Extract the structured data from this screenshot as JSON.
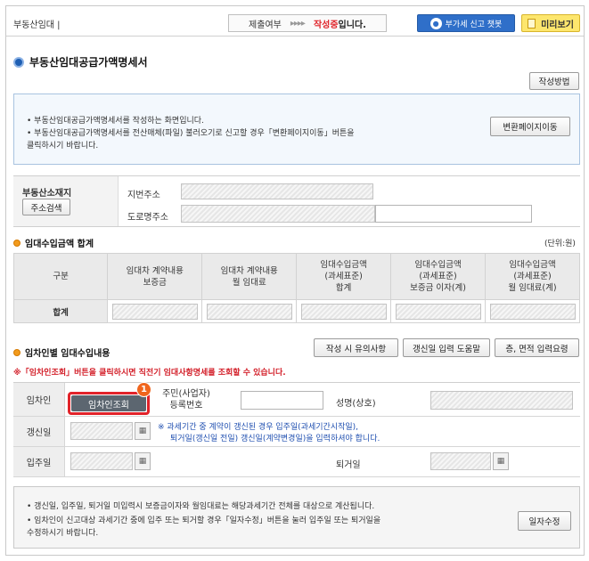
{
  "topbar": {
    "breadcrumb": "부동산임대 |",
    "submit_label": "제출여부",
    "submit_arrows": "▸▸▸▸",
    "submit_state": "작성중",
    "submit_state_suffix": "입니다.",
    "vat_button": "부가세 신고 챗봇",
    "preview_button": "미리보기"
  },
  "page": {
    "title": "부동산임대공급가액명세서"
  },
  "buttons": {
    "how_to": "작성방법",
    "convert_page": "변환페이지이동",
    "address_search": "주소검색",
    "writing_notes": "작성 시 유의사항",
    "renewal_help": "갱신일 입력 도움말",
    "floor_area_help": "층, 면적 입력요령",
    "tenant_lookup": "임차인조회",
    "date_edit": "일자수정"
  },
  "info": {
    "line1": "• 부동산임대공급가액명세서를 작성하는 화면입니다.",
    "line2": "• 부동산임대공급가액명세서를 전산매체(파일) 불러오기로 신고할 경우「변환페이지이동」버튼을",
    "line3": "  클릭하시기 바랍니다."
  },
  "address": {
    "section_label": "부동산소재지",
    "jibun_label": "지번주소",
    "road_label": "도로명주소"
  },
  "summary": {
    "title": "임대수입금액 합계",
    "unit": "(단위:원)",
    "headers": [
      "구분",
      "임대차 계약내용\n보증금",
      "임대차 계약내용\n월 임대료",
      "임대수입금액\n(과세표준)\n합계",
      "임대수입금액\n(과세표준)\n보증금 이자(계)",
      "임대수입금액\n(과세표준)\n월 임대료(계)"
    ],
    "total_row_label": "합계"
  },
  "tenant": {
    "title": "임차인별 임대수입내용",
    "notice": "※「임차인조회」버튼을 클릭하시면 직전기 임대사항명세를 조회할 수 있습니다.",
    "tenant_label": "임차인",
    "badge": "1",
    "id_label_1": "주민(사업자)",
    "id_label_2": "등록번호",
    "name_label": "성명(상호)",
    "renewal_label": "갱신일",
    "renewal_note_1": "※ 과세기간 중 계약이 갱신된 경우 입주일(과세기간시작일),",
    "renewal_note_2": "퇴거일(갱신일 전일) 갱신일(계약변경일)을 입력하셔야 합니다.",
    "move_in_label": "입주일",
    "move_out_label": "퇴거일",
    "calendar_icon": "▦"
  },
  "bottom": {
    "line1": "• 갱신일, 입주일, 퇴거일 미입력시 보증금이자와 월임대료는 해당과세기간 전체를 대상으로 계산됩니다.",
    "line2": "• 임차인이 신고대상 과세기간 중에 입주 또는 퇴거할 경우「일자수정」버튼을 눌러 입주일 또는 퇴거일을",
    "line3": "  수정하시기 바랍니다."
  }
}
